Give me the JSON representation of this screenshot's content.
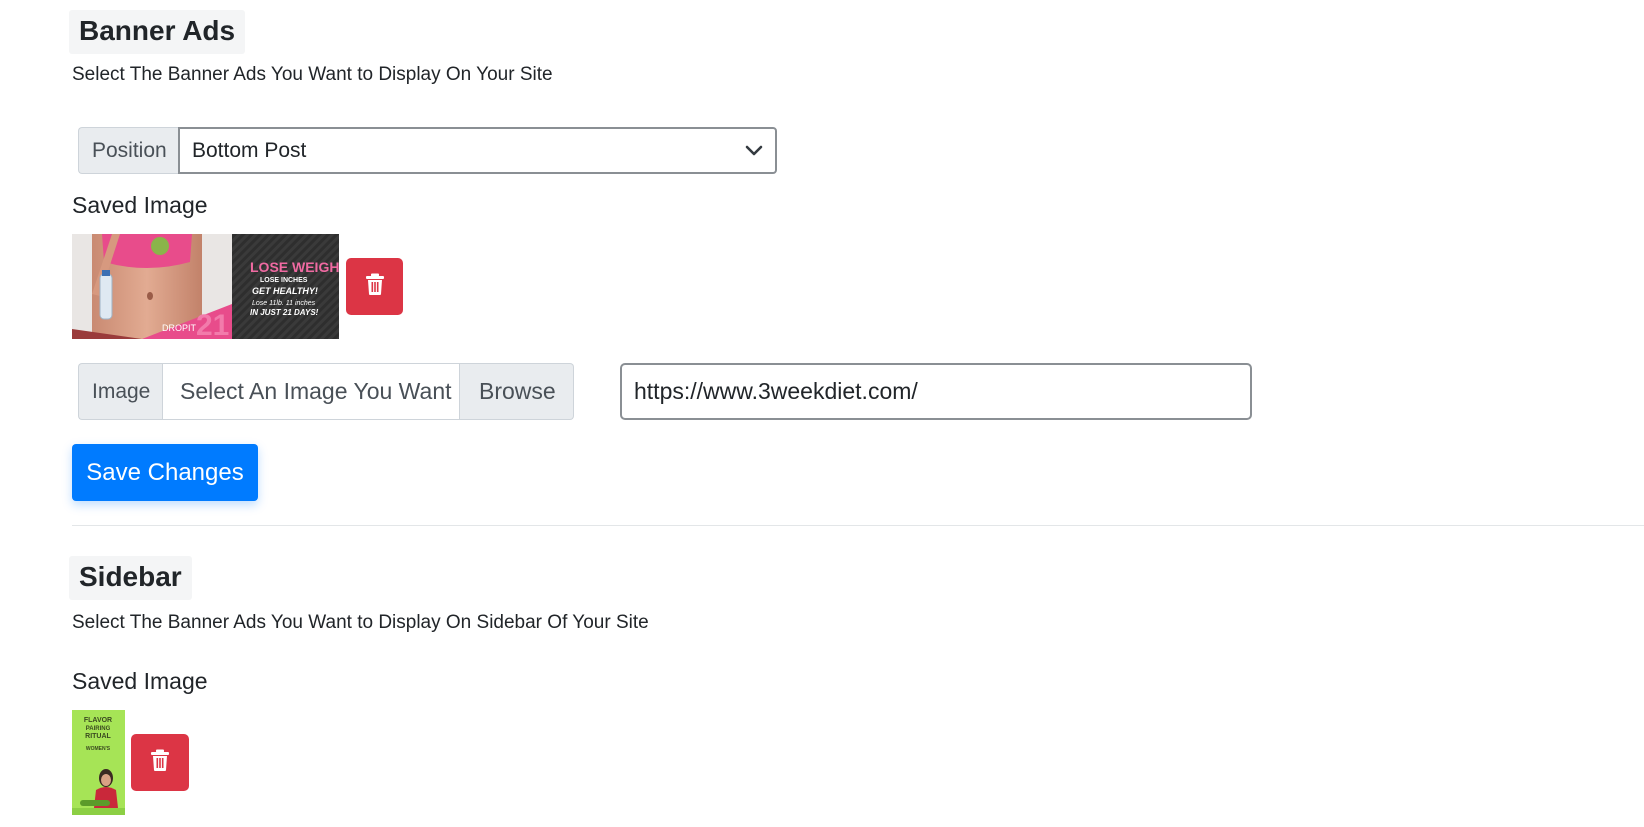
{
  "banner_ads": {
    "title": "Banner Ads",
    "description": "Select The Banner Ads You Want to Display On Your Site",
    "position_label": "Position",
    "position_value": "Bottom Post",
    "saved_image_label": "Saved Image",
    "banner_image": {
      "headline": "LOSE WEIGHT",
      "subline": "LOSE INCHES",
      "tagline": "GET HEALTHY!",
      "detail": "Lose 11lb. 11 inches",
      "footer": "IN JUST 21 DAYS!",
      "brand": "DROPIT",
      "number": "21"
    },
    "image_label": "Image",
    "image_placeholder": "Select An Image You Want",
    "browse_label": "Browse",
    "url_value": "https://www.3weekdiet.com/",
    "save_label": "Save Changes"
  },
  "sidebar": {
    "title": "Sidebar",
    "description": "Select The Banner Ads You Want to Display On Sidebar Of Your Site",
    "saved_image_label": "Saved Image",
    "sidebar_image": {
      "line1": "FLAVOR",
      "line2": "PAIRING",
      "line3": "RITUAL",
      "line4": "WOMEN'S"
    }
  },
  "colors": {
    "primary": "#007bff",
    "danger": "#dc3545",
    "addon_bg": "#e9ecef",
    "heading_bg": "#f4f5f6"
  },
  "icons": {
    "delete": "trash-icon",
    "select": "chevron-down-icon"
  }
}
